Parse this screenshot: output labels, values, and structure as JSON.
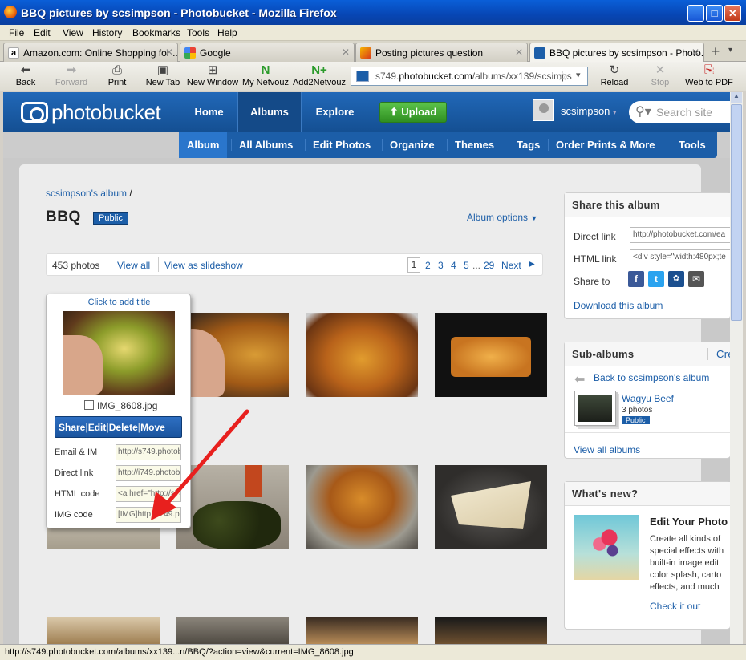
{
  "window": {
    "title": "BBQ pictures by scsimpson - Photobucket - Mozilla Firefox"
  },
  "menu": [
    "File",
    "Edit",
    "View",
    "History",
    "Bookmarks",
    "Tools",
    "Help"
  ],
  "tabs": [
    {
      "label": "Amazon.com: Online Shopping for ...",
      "active": false
    },
    {
      "label": "Google",
      "active": false
    },
    {
      "label": "Posting pictures question",
      "active": false
    },
    {
      "label": "BBQ pictures by scsimpson - Photo...",
      "active": true
    }
  ],
  "toolbar": {
    "back": "Back",
    "forward": "Forward",
    "print": "Print",
    "new_tab": "New Tab",
    "new_window": "New Window",
    "my_netvouz": "My Netvouz",
    "add2netvouz": "Add2Netvouz",
    "reload": "Reload",
    "stop": "Stop",
    "web_to_pdf": "Web to PDF",
    "url_prefix": "s749.",
    "url_host": "photobucket.com",
    "url_path": "/albums/xx139/scsimps"
  },
  "pb": {
    "logo": "photobucket",
    "nav": [
      "Home",
      "Albums",
      "Explore"
    ],
    "upload": "Upload",
    "username": "scsimpson",
    "search_placeholder": "Search site",
    "subnav": [
      "Album",
      "All Albums",
      "Edit Photos",
      "Organize",
      "Themes",
      "Tags",
      "Order Prints & More",
      "Tools"
    ]
  },
  "album": {
    "breadcrumb": "scsimpson's album",
    "breadcrumb_sep": "/",
    "title": "BBQ",
    "badge": "Public",
    "options": "Album options",
    "count": "453 photos",
    "view_all": "View all",
    "slideshow": "View as slideshow",
    "pages": [
      "1",
      "2",
      "3",
      "4",
      "5"
    ],
    "ellipsis": "...",
    "last_page": "29",
    "next": "Next"
  },
  "popup": {
    "add_title": "Click to add title",
    "filename": "IMG_8608.jpg",
    "actions": [
      "Share",
      "Edit",
      "Delete",
      "Move"
    ],
    "fields": [
      {
        "label": "Email & IM",
        "value": "http://s749.photob"
      },
      {
        "label": "Direct link",
        "value": "http://i749.photobu"
      },
      {
        "label": "HTML code",
        "value": "<a href=\"http://s74"
      },
      {
        "label": "IMG code",
        "value": "[IMG]http://i749.ph"
      }
    ]
  },
  "share": {
    "heading": "Share this album",
    "direct_label": "Direct link",
    "direct_value": "http://photobucket.com/ea",
    "html_label": "HTML link",
    "html_value": "<div style=\"width:480px;te",
    "share_to": "Share to",
    "download": "Download this album"
  },
  "subalbums": {
    "heading": "Sub-albums",
    "create": "Cre",
    "back": "Back to scsimpson's album",
    "name": "Wagyu Beef",
    "photos": "3 photos",
    "badge": "Public",
    "view_all": "View all albums"
  },
  "whatsnew": {
    "heading": "What's new?",
    "title": "Edit Your Photo",
    "lines": [
      "Create all kinds of",
      "special effects with",
      "built-in image edit",
      "color splash, carto",
      "effects, and much"
    ],
    "link": "Check it out"
  },
  "status": {
    "text": "http://s749.photobucket.com/albums/xx139...n/BBQ/?action=view&current=IMG_8608.jpg"
  },
  "colors": {
    "brand": "#1c5ea8",
    "upload": "#3aa52b",
    "arrow": "#e8201e"
  }
}
